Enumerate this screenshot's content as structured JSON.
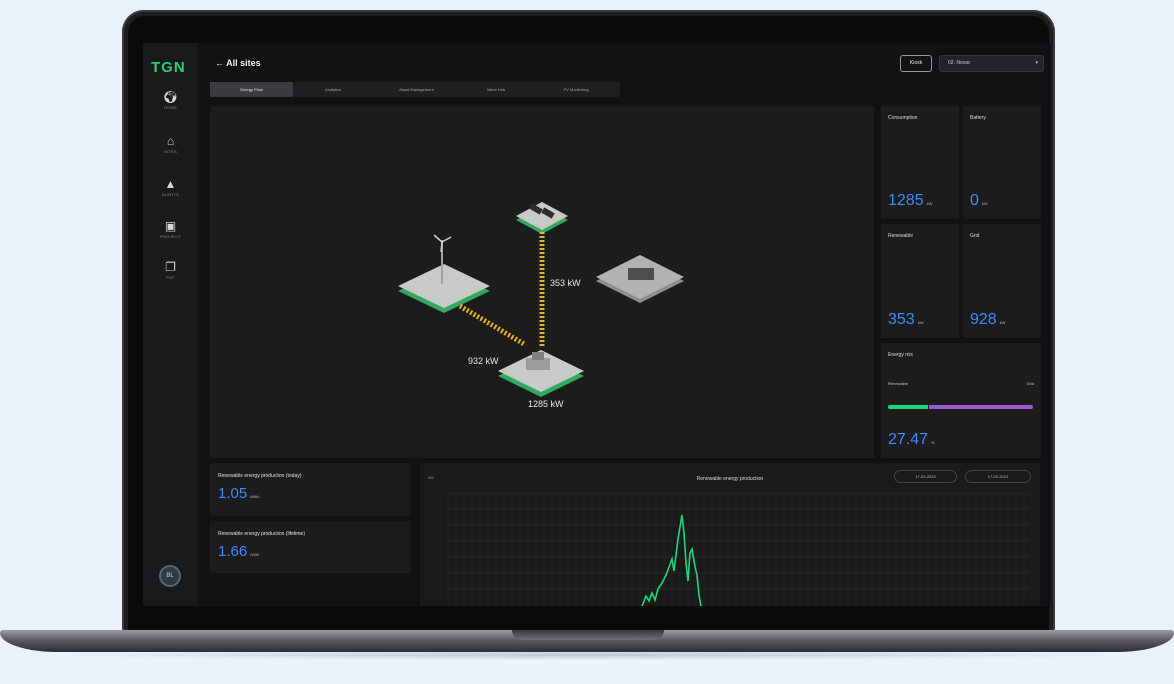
{
  "app": {
    "logo": "TGN",
    "back_label": "All sites",
    "kiosk_label": "Kiosk",
    "site_select_value": "02. Novac"
  },
  "sidebar": {
    "items": [
      {
        "label": "HOME",
        "icon": "globe-icon"
      },
      {
        "label": "SITES",
        "icon": "building-icon"
      },
      {
        "label": "ALERTS",
        "icon": "alert-icon"
      },
      {
        "label": "PROJECT",
        "icon": "project-icon"
      },
      {
        "label": "PDF",
        "icon": "pdf-icon"
      }
    ],
    "avatar_initials": "BL"
  },
  "tabs": [
    {
      "label": "Energy Flow",
      "active": true
    },
    {
      "label": "Analytics",
      "active": false
    },
    {
      "label": "Asset Management",
      "active": false
    },
    {
      "label": "Value Hub",
      "active": false
    },
    {
      "label": "PV Monitoring",
      "active": false
    }
  ],
  "flow": {
    "solar_to_load": "353 kW",
    "grid_to_load": "932 kW",
    "load": "1285 kW"
  },
  "cards": {
    "consumption": {
      "title": "Consumption",
      "value": "1285",
      "unit": "kW"
    },
    "battery": {
      "title": "Battery",
      "value": "0",
      "unit": "kW"
    },
    "renewable": {
      "title": "Renewable",
      "value": "353",
      "unit": "kW"
    },
    "grid": {
      "title": "Grid",
      "value": "928",
      "unit": "kW"
    },
    "energy_mix": {
      "title": "Energy mix",
      "left_label": "Renewable",
      "right_label": "Grid",
      "value": "27.47",
      "unit": "%",
      "renewable_percent": 27.47
    }
  },
  "stats": {
    "today": {
      "title": "Renewable energy production (today)",
      "value": "1.05",
      "unit": "MWh"
    },
    "lifetime": {
      "title": "Renewable energy production (lifetime)",
      "value": "1.66",
      "unit": "GWh"
    }
  },
  "chart": {
    "title": "Renewable energy production",
    "unit_label": "kW",
    "date_from": "17-09-2024",
    "date_to": "17-09-2024"
  },
  "colors": {
    "accent_blue": "#3d8bff",
    "renewable_green": "#1ed67a",
    "grid_purple": "#9b59d6",
    "flow_yellow": "#e8b32c"
  }
}
